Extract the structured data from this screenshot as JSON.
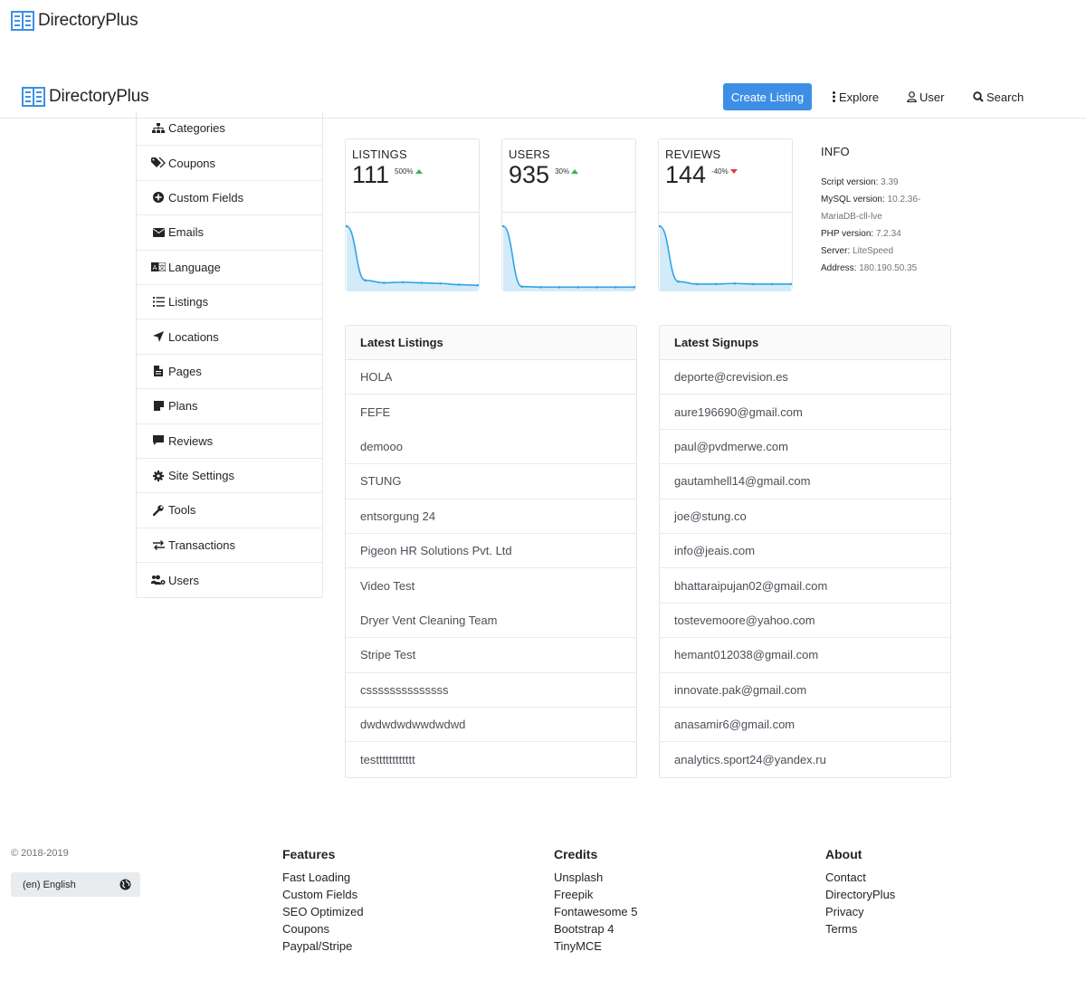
{
  "brand": {
    "name": "DirectoryPlus",
    "color": "#3d8fe5"
  },
  "nav": {
    "create_listing": "Create Listing",
    "explore": "Explore",
    "user": "User",
    "search": "Search"
  },
  "sidebar": {
    "items": [
      {
        "label": "Categories",
        "icon": "sitemap-icon"
      },
      {
        "label": "Coupons",
        "icon": "tags-icon"
      },
      {
        "label": "Custom Fields",
        "icon": "plus-circle-icon"
      },
      {
        "label": "Emails",
        "icon": "envelope-icon"
      },
      {
        "label": "Language",
        "icon": "language-icon"
      },
      {
        "label": "Listings",
        "icon": "list-icon"
      },
      {
        "label": "Locations",
        "icon": "location-arrow-icon"
      },
      {
        "label": "Pages",
        "icon": "file-icon"
      },
      {
        "label": "Plans",
        "icon": "sticky-note-icon"
      },
      {
        "label": "Reviews",
        "icon": "comment-icon"
      },
      {
        "label": "Site Settings",
        "icon": "cog-icon"
      },
      {
        "label": "Tools",
        "icon": "wrench-icon"
      },
      {
        "label": "Transactions",
        "icon": "exchange-icon"
      },
      {
        "label": "Users",
        "icon": "users-cog-icon"
      }
    ]
  },
  "stats": [
    {
      "label": "LISTINGS",
      "value": "111",
      "change": "500%",
      "trend": "up"
    },
    {
      "label": "USERS",
      "value": "935",
      "change": "30%",
      "trend": "up"
    },
    {
      "label": "REVIEWS",
      "value": "144",
      "change": "-40%",
      "trend": "down"
    }
  ],
  "chart_data": [
    {
      "type": "area",
      "values": [
        100,
        12,
        8,
        9,
        8,
        7,
        5,
        4
      ],
      "color": "#2fa4e7"
    },
    {
      "type": "area",
      "values": [
        100,
        2,
        1,
        1,
        1,
        1,
        1,
        1
      ],
      "color": "#2fa4e7"
    },
    {
      "type": "area",
      "values": [
        100,
        10,
        6,
        6,
        7,
        6,
        6,
        6
      ],
      "color": "#2fa4e7"
    }
  ],
  "info": {
    "title": "INFO",
    "script_version_label": "Script version:",
    "script_version": "3.39",
    "mysql_version_label": "MySQL version:",
    "mysql_version_a": "10.2.36-",
    "mysql_version_b": "MariaDB-cll-lve",
    "php_version_label": "PHP version:",
    "php_version": "7.2.34",
    "server_label": "Server:",
    "server": "LiteSpeed",
    "address_label": "Address:",
    "address": "180.190.50.35"
  },
  "latest_listings": {
    "title": "Latest Listings",
    "items": [
      "HOLA",
      "FEFE",
      "demooo",
      "STUNG",
      "entsorgung 24",
      "Pigeon HR Solutions Pvt. Ltd",
      "Video Test",
      "Dryer Vent Cleaning Team",
      "Stripe Test",
      "cssssssssssssss",
      "dwdwdwdwwdwdwd",
      "testttttttttttt"
    ]
  },
  "latest_signups": {
    "title": "Latest Signups",
    "items": [
      "deporte@crevision.es",
      "aure196690@gmail.com",
      "paul@pvdmerwe.com",
      "gautamhell14@gmail.com",
      "joe@stung.co",
      "info@jeais.com",
      "bhattaraipujan02@gmail.com",
      "tostevemoore@yahoo.com",
      "hemant012038@gmail.com",
      "innovate.pak@gmail.com",
      "anasamir6@gmail.com",
      "analytics.sport24@yandex.ru"
    ]
  },
  "footer": {
    "copyright": "© 2018-2019",
    "language": "(en) English",
    "columns": [
      {
        "title": "Features",
        "links": [
          "Fast Loading",
          "Custom Fields",
          "SEO Optimized",
          "Coupons",
          "Paypal/Stripe"
        ]
      },
      {
        "title": "Credits",
        "links": [
          "Unsplash",
          "Freepik",
          "Fontawesome 5",
          "Bootstrap 4",
          "TinyMCE"
        ]
      },
      {
        "title": "About",
        "links": [
          "Contact",
          "DirectoryPlus",
          "Privacy",
          "Terms"
        ]
      }
    ]
  }
}
